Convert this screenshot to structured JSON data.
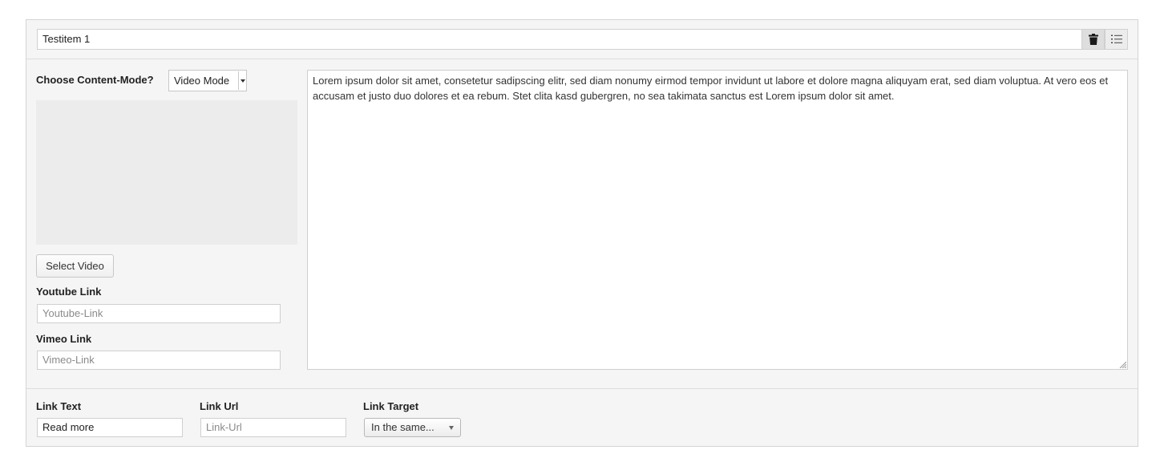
{
  "header": {
    "title_value": "Testitem 1",
    "trash_icon": "trash-icon",
    "list_icon": "ordered-list-icon"
  },
  "content_mode": {
    "label": "Choose Content-Mode?",
    "selected": "Video Mode"
  },
  "video": {
    "select_button": "Select Video",
    "youtube_label": "Youtube Link",
    "youtube_placeholder": "Youtube-Link",
    "vimeo_label": "Vimeo Link",
    "vimeo_placeholder": "Vimeo-Link"
  },
  "body_text": "Lorem ipsum dolor sit amet, consetetur sadipscing elitr, sed diam nonumy eirmod tempor invidunt ut labore et dolore magna aliquyam erat, sed diam voluptua. At vero eos et accusam et justo duo dolores et ea rebum. Stet clita kasd gubergren, no sea takimata sanctus est Lorem ipsum dolor sit amet.",
  "footer": {
    "link_text_label": "Link Text",
    "link_text_value": "Read more",
    "link_url_label": "Link Url",
    "link_url_placeholder": "Link-Url",
    "link_target_label": "Link Target",
    "link_target_selected": "In the same..."
  }
}
